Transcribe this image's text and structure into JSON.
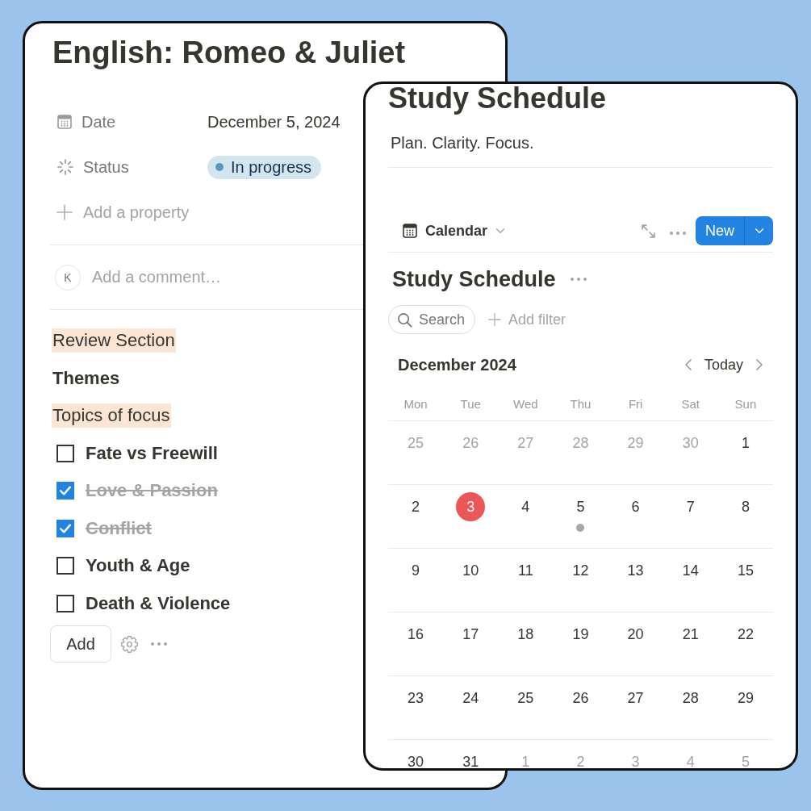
{
  "note_page": {
    "title": "English: Romeo & Juliet",
    "properties": [
      {
        "kind": "date",
        "label": "Date",
        "value": "December 5, 2024"
      },
      {
        "kind": "status",
        "label": "Status",
        "value": "In progress"
      }
    ],
    "add_property": "Add a property",
    "comment": {
      "avatar": "K",
      "placeholder": "Add a comment…"
    },
    "blocks": [
      {
        "kind": "highlight",
        "text": "Review Section"
      },
      {
        "kind": "heading",
        "text": "Themes"
      },
      {
        "kind": "highlight",
        "text": "Topics of focus"
      }
    ],
    "todos": [
      {
        "label": "Fate vs Freewill",
        "checked": false
      },
      {
        "label": "Love & Passion",
        "checked": true
      },
      {
        "label": "Conflict",
        "checked": true
      },
      {
        "label": "Youth & Age",
        "checked": false
      },
      {
        "label": "Death & Violence",
        "checked": false
      }
    ],
    "add_button": "Add"
  },
  "calendar_page": {
    "title": "Study Schedule",
    "subtitle": "Plan. Clarity. Focus.",
    "view": {
      "label": "Calendar"
    },
    "new_button": "New",
    "database_title": "Study Schedule",
    "search": {
      "placeholder": "Search"
    },
    "add_filter": "Add filter",
    "month": "December 2024",
    "today_button": "Today",
    "weekdays": [
      "Mon",
      "Tue",
      "Wed",
      "Thu",
      "Fri",
      "Sat",
      "Sun"
    ],
    "weeks": [
      [
        {
          "label": "25",
          "in_month": false,
          "today": false,
          "event": false
        },
        {
          "label": "26",
          "in_month": false,
          "today": false,
          "event": false
        },
        {
          "label": "27",
          "in_month": false,
          "today": false,
          "event": false
        },
        {
          "label": "28",
          "in_month": false,
          "today": false,
          "event": false
        },
        {
          "label": "29",
          "in_month": false,
          "today": false,
          "event": false
        },
        {
          "label": "30",
          "in_month": false,
          "today": false,
          "event": false
        },
        {
          "label": "1",
          "in_month": true,
          "today": false,
          "event": false
        }
      ],
      [
        {
          "label": "2",
          "in_month": true,
          "today": false,
          "event": false
        },
        {
          "label": "3",
          "in_month": true,
          "today": true,
          "event": false
        },
        {
          "label": "4",
          "in_month": true,
          "today": false,
          "event": false
        },
        {
          "label": "5",
          "in_month": true,
          "today": false,
          "event": true
        },
        {
          "label": "6",
          "in_month": true,
          "today": false,
          "event": false
        },
        {
          "label": "7",
          "in_month": true,
          "today": false,
          "event": false
        },
        {
          "label": "8",
          "in_month": true,
          "today": false,
          "event": false
        }
      ],
      [
        {
          "label": "9",
          "in_month": true,
          "today": false,
          "event": false
        },
        {
          "label": "10",
          "in_month": true,
          "today": false,
          "event": false
        },
        {
          "label": "11",
          "in_month": true,
          "today": false,
          "event": false
        },
        {
          "label": "12",
          "in_month": true,
          "today": false,
          "event": false
        },
        {
          "label": "13",
          "in_month": true,
          "today": false,
          "event": false
        },
        {
          "label": "14",
          "in_month": true,
          "today": false,
          "event": false
        },
        {
          "label": "15",
          "in_month": true,
          "today": false,
          "event": false
        }
      ],
      [
        {
          "label": "16",
          "in_month": true,
          "today": false,
          "event": false
        },
        {
          "label": "17",
          "in_month": true,
          "today": false,
          "event": false
        },
        {
          "label": "18",
          "in_month": true,
          "today": false,
          "event": false
        },
        {
          "label": "19",
          "in_month": true,
          "today": false,
          "event": false
        },
        {
          "label": "20",
          "in_month": true,
          "today": false,
          "event": false
        },
        {
          "label": "21",
          "in_month": true,
          "today": false,
          "event": false
        },
        {
          "label": "22",
          "in_month": true,
          "today": false,
          "event": false
        }
      ],
      [
        {
          "label": "23",
          "in_month": true,
          "today": false,
          "event": false
        },
        {
          "label": "24",
          "in_month": true,
          "today": false,
          "event": false
        },
        {
          "label": "25",
          "in_month": true,
          "today": false,
          "event": false
        },
        {
          "label": "26",
          "in_month": true,
          "today": false,
          "event": false
        },
        {
          "label": "27",
          "in_month": true,
          "today": false,
          "event": false
        },
        {
          "label": "28",
          "in_month": true,
          "today": false,
          "event": false
        },
        {
          "label": "29",
          "in_month": true,
          "today": false,
          "event": false
        }
      ],
      [
        {
          "label": "30",
          "in_month": true,
          "today": false,
          "event": false
        },
        {
          "label": "31",
          "in_month": true,
          "today": false,
          "event": false
        },
        {
          "label": "1",
          "in_month": false,
          "today": false,
          "event": false
        },
        {
          "label": "2",
          "in_month": false,
          "today": false,
          "event": false
        },
        {
          "label": "3",
          "in_month": false,
          "today": false,
          "event": false
        },
        {
          "label": "4",
          "in_month": false,
          "today": false,
          "event": false
        },
        {
          "label": "5",
          "in_month": false,
          "today": false,
          "event": false
        }
      ]
    ]
  }
}
